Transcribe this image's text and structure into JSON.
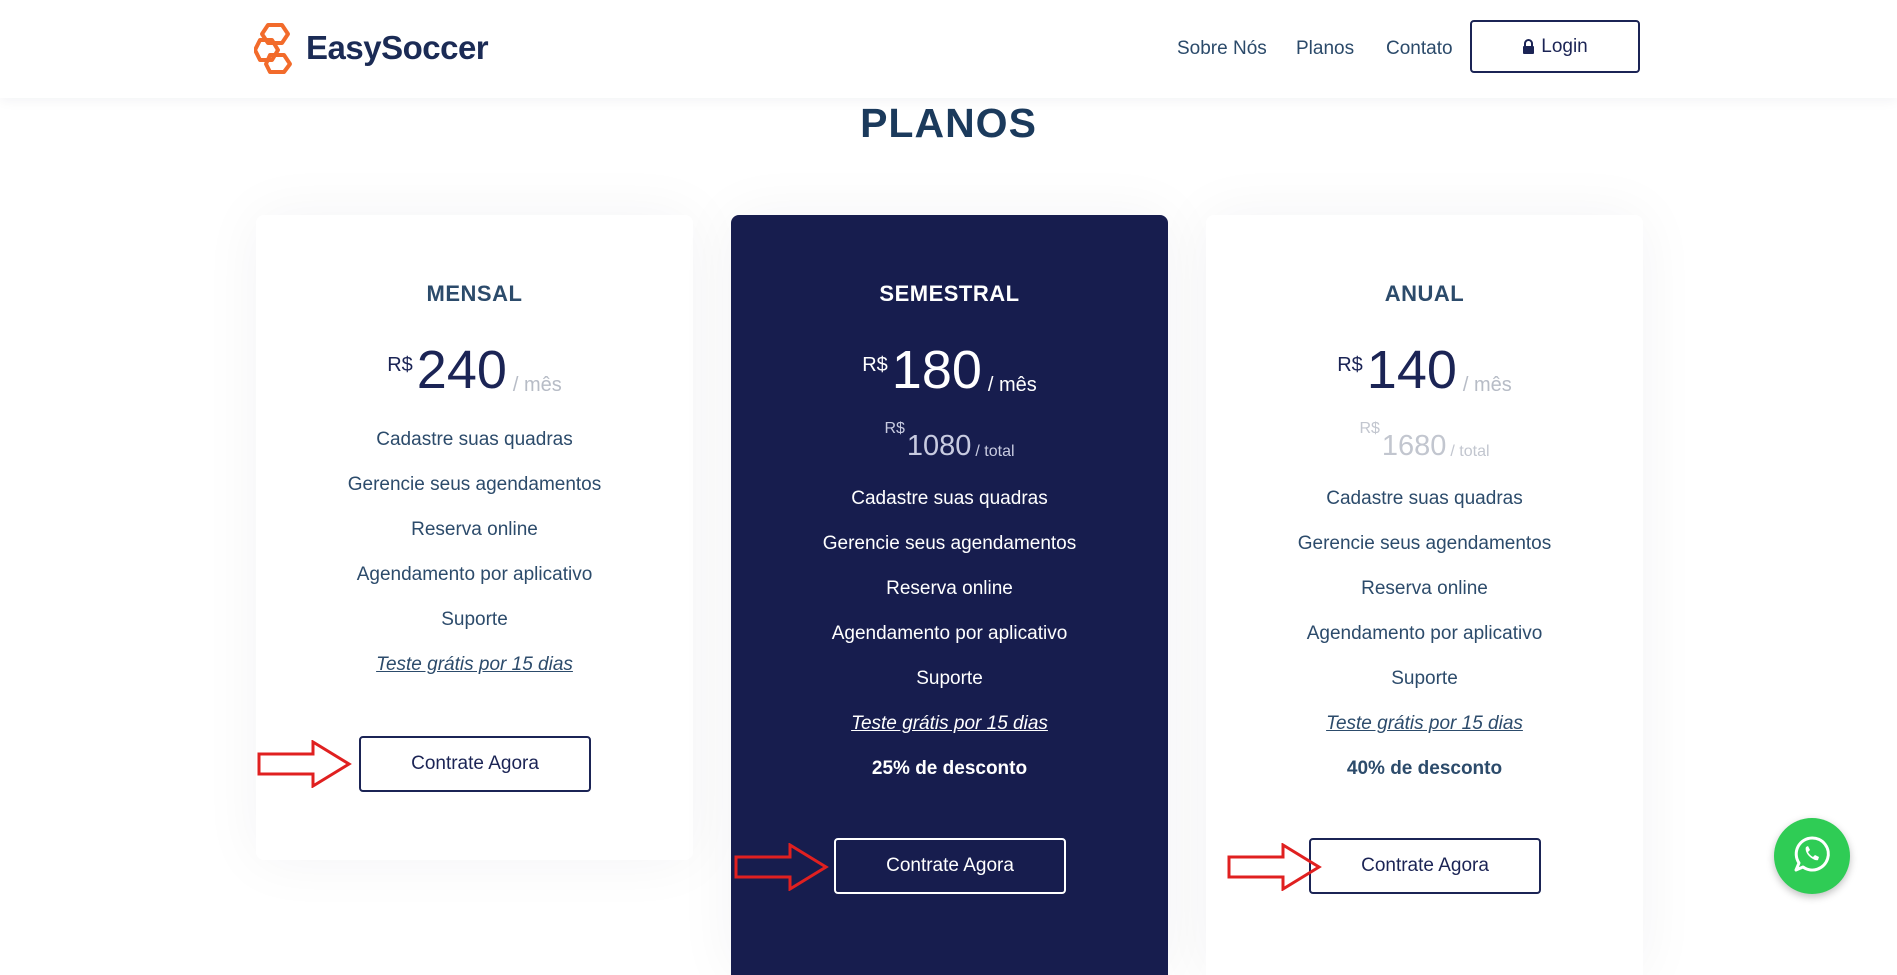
{
  "header": {
    "brand": "EasySoccer",
    "nav": [
      {
        "label": "Sobre Nós"
      },
      {
        "label": "Planos"
      },
      {
        "label": "Contato"
      }
    ],
    "login_label": "Login"
  },
  "section": {
    "title": "PLANOS"
  },
  "plans": [
    {
      "name": "MENSAL",
      "currency": "R$",
      "price": "240",
      "per": "/ mês",
      "features": [
        "Cadastre suas quadras",
        "Gerencie seus agendamentos",
        "Reserva online",
        "Agendamento por aplicativo",
        "Suporte"
      ],
      "trial": "Teste grátis por 15 dias",
      "cta": "Contrate Agora"
    },
    {
      "name": "SEMESTRAL",
      "currency": "R$",
      "price": "180",
      "per": "/ mês",
      "total_currency": "R$",
      "total": "1080",
      "total_per": "/ total",
      "features": [
        "Cadastre suas quadras",
        "Gerencie seus agendamentos",
        "Reserva online",
        "Agendamento por aplicativo",
        "Suporte"
      ],
      "trial": "Teste grátis por 15 dias",
      "discount": "25% de desconto",
      "cta": "Contrate Agora"
    },
    {
      "name": "ANUAL",
      "currency": "R$",
      "price": "140",
      "per": "/ mês",
      "total_currency": "R$",
      "total": "1680",
      "total_per": "/ total",
      "features": [
        "Cadastre suas quadras",
        "Gerencie seus agendamentos",
        "Reserva online",
        "Agendamento por aplicativo",
        "Suporte"
      ],
      "trial": "Teste grátis por 15 dias",
      "discount": "40% de desconto",
      "cta": "Contrate Agora"
    }
  ],
  "icons": {
    "logo": "hexagon-logo-icon",
    "lock": "lock-icon",
    "arrow": "right-arrow-icon",
    "whatsapp": "whatsapp-icon"
  },
  "colors": {
    "brand_orange": "#f26b2b",
    "navy": "#171d4e",
    "text": "#2c4b6b",
    "whatsapp_green": "#2fcc55",
    "annotation_red": "#e02020"
  }
}
